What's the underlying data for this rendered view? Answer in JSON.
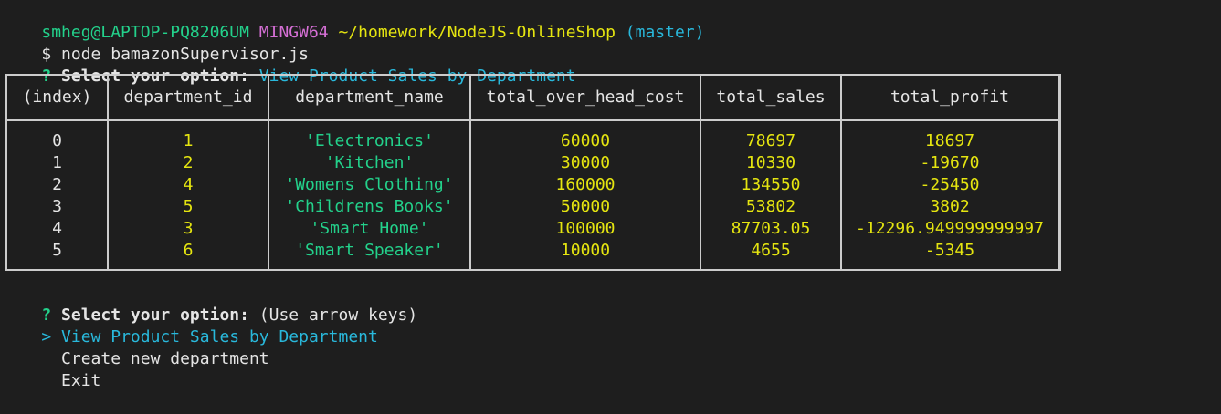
{
  "prompt": {
    "user_host": "smheg@LAPTOP-PQ8206UM",
    "shell": "MINGW64",
    "path": "~/homework/NodeJS-OnlineShop",
    "branch": "(master)",
    "dollar": "$",
    "command": "node bamazonSupervisor.js"
  },
  "question1": {
    "mark": "?",
    "text": "Select your option:",
    "answer": "View Product Sales by Department"
  },
  "table": {
    "headers": [
      "(index)",
      "department_id",
      "department_name",
      "total_over_head_cost",
      "total_sales",
      "total_profit"
    ],
    "rows": [
      [
        "0",
        "1",
        "'Electronics'",
        "60000",
        "78697",
        "18697"
      ],
      [
        "1",
        "2",
        "'Kitchen'",
        "30000",
        "10330",
        "-19670"
      ],
      [
        "2",
        "4",
        "'Womens Clothing'",
        "160000",
        "134550",
        "-25450"
      ],
      [
        "3",
        "5",
        "'Childrens Books'",
        "50000",
        "53802",
        "3802"
      ],
      [
        "4",
        "3",
        "'Smart Home'",
        "100000",
        "87703.05",
        "-12296.949999999997"
      ],
      [
        "5",
        "6",
        "'Smart Speaker'",
        "10000",
        "4655",
        "-5345"
      ]
    ]
  },
  "question2": {
    "mark": "?",
    "text": "Select your option:",
    "hint": "(Use arrow keys)"
  },
  "menu": {
    "pointer": ">",
    "items": [
      "View Product Sales by Department",
      "Create new department",
      "Exit"
    ]
  },
  "colors": {
    "background": "#1e1e1e",
    "green": "#23d18b",
    "magenta": "#d670d6",
    "yellow": "#e5e510",
    "cyan": "#29b8db"
  }
}
